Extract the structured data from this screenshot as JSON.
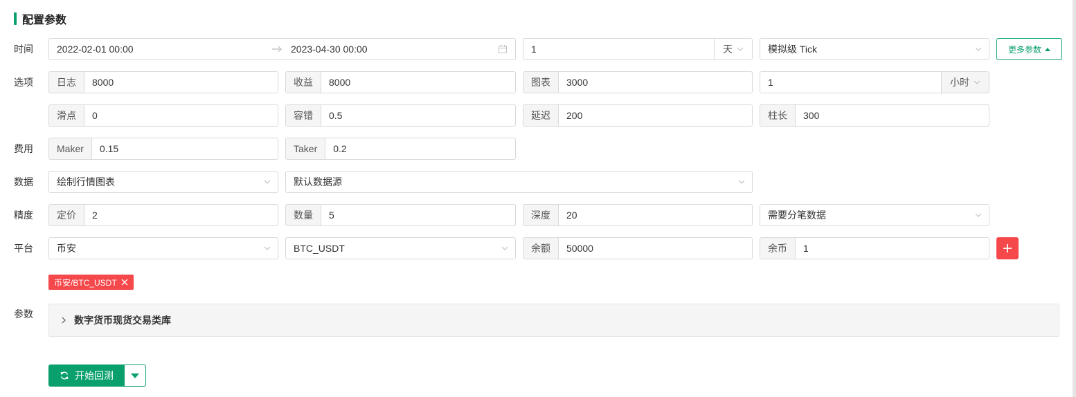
{
  "section_title": "配置参数",
  "rows": {
    "time": "时间",
    "options": "选项",
    "fees": "费用",
    "data": "数据",
    "precision": "精度",
    "platform": "平台",
    "params": "参数"
  },
  "time": {
    "start": "2022-02-01 00:00",
    "end": "2023-04-30 00:00",
    "period_value": "1",
    "period_unit": "天",
    "mode": "模拟级 Tick",
    "more_button": "更多参数"
  },
  "options": {
    "log_label": "日志",
    "log_value": "8000",
    "profit_label": "收益",
    "profit_value": "8000",
    "chart_label": "图表",
    "chart_value": "3000",
    "interval_value": "1",
    "interval_unit": "小时",
    "slippage_label": "滑点",
    "slippage_value": "0",
    "tolerance_label": "容错",
    "tolerance_value": "0.5",
    "delay_label": "延迟",
    "delay_value": "200",
    "bar_label": "柱长",
    "bar_value": "300"
  },
  "fees": {
    "maker_label": "Maker",
    "maker_value": "0.15",
    "taker_label": "Taker",
    "taker_value": "0.2"
  },
  "data": {
    "chart_select": "绘制行情图表",
    "source_select": "默认数据源"
  },
  "precision": {
    "price_label": "定价",
    "price_value": "2",
    "amount_label": "数量",
    "amount_value": "5",
    "depth_label": "深度",
    "depth_value": "20",
    "tick_select": "需要分笔数据"
  },
  "platform": {
    "exchange": "币安",
    "pair": "BTC_USDT",
    "balance_label": "余额",
    "balance_value": "50000",
    "coin_label": "余币",
    "coin_value": "1",
    "tag": "币安/BTC_USDT"
  },
  "params": {
    "library": "数字货币现货交易类库"
  },
  "start_button": "开始回测",
  "colors": {
    "accent": "#0aa06e",
    "danger": "#f5484b"
  }
}
